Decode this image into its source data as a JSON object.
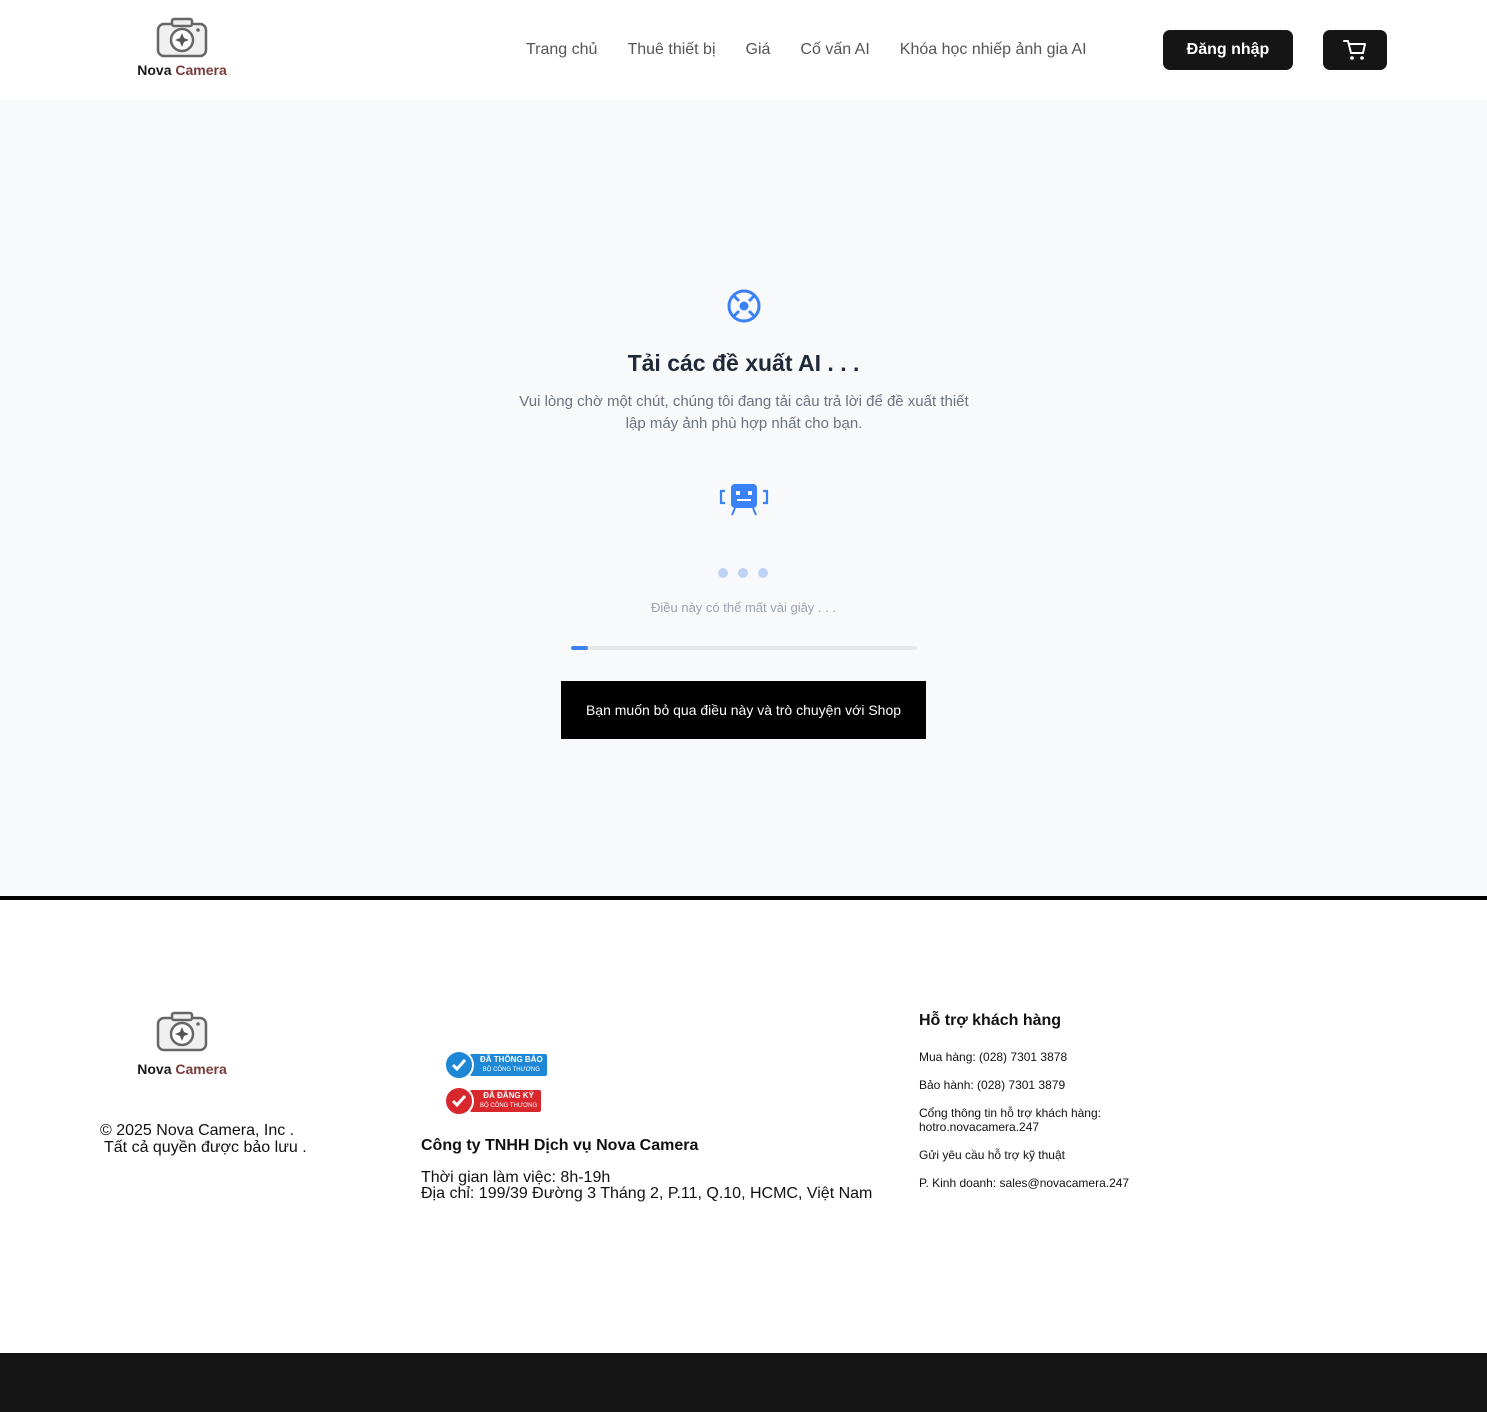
{
  "header": {
    "logo": {
      "brand": "Nova",
      "accent": "Camera"
    },
    "nav": [
      "Trang chủ",
      "Thuê thiết bị",
      "Giá",
      "Cố vấn AI",
      "Khóa học nhiếp ảnh gia AI"
    ],
    "login_label": "Đăng nhập",
    "cart_icon": "cart-icon"
  },
  "loading": {
    "title": "Tải các đề xuất AI . . .",
    "subtitle": "Vui lòng chờ một chút, chúng tôi đang tải câu trả lời để đề xuất thiết lập máy ảnh phù hợp nhất cho bạn.",
    "hint": "Điều này có thể mất vài giây . . .",
    "progress": 0.05,
    "skip_label": "Bạn muốn bỏ qua điều này và trò chuyện với Shop",
    "icons": [
      "target-icon",
      "robot-icon"
    ]
  },
  "footer": {
    "logo": {
      "brand": "Nova",
      "accent": "Camera"
    },
    "copyright_line1": "© 2025 Nova Camera, Inc .",
    "copyright_line2": "Tất cả quyền được bảo lưu .",
    "badges": [
      {
        "title": "ĐÃ THÔNG BÁO",
        "sub": "BỘ CÔNG THƯƠNG",
        "color": "#1e88d6"
      },
      {
        "title": "ĐÃ ĐĂNG KÝ",
        "sub": "BỘ CÔNG THƯƠNG",
        "color": "#d8282e"
      }
    ],
    "company": "Công ty TNHH Dịch vụ Nova Camera",
    "hours": "Thời gian làm việc: 8h-19h",
    "address": "Địa chỉ: 199/39 Đường 3 Tháng 2, P.11, Q.10, HCMC, Việt Nam",
    "support": {
      "title": "Hỗ trợ khách hàng",
      "items": [
        "Mua hàng: (028) 7301 3878",
        "Bảo hành: (028) 7301 3879",
        "Cổng thông tin hỗ trợ khách hàng: hotro.novacamera.247",
        "Gửi yêu cầu hỗ trợ kỹ thuật",
        "P. Kinh doanh: sales@novacamera.247"
      ]
    }
  },
  "colors": {
    "accent": "#3b82f6",
    "dark": "#151515",
    "page_bg": "#f8f9fb"
  }
}
